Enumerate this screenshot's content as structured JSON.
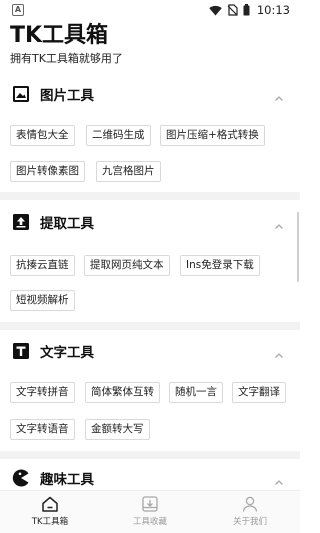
{
  "status_bar": {
    "app_badge": "A",
    "time": "10:13"
  },
  "header": {
    "title": "TK工具箱",
    "subtitle": "拥有TK工具箱就够用了"
  },
  "sections": [
    {
      "title": "图片工具",
      "icon": "image-icon",
      "items": [
        "表情包大全",
        "二维码生成",
        "图片压缩+格式转换",
        "图片转像素图",
        "九宫格图片"
      ]
    },
    {
      "title": "提取工具",
      "icon": "upload-box-icon",
      "items": [
        "抗揍云直链",
        "提取网页纯文本",
        "Ins免登录下载",
        "短视频解析"
      ]
    },
    {
      "title": "文字工具",
      "icon": "text-t-icon",
      "items": [
        "文字转拼音",
        "简体繁体互转",
        "随机一言",
        "文字翻译",
        "文字转语音",
        "金额转大写"
      ]
    },
    {
      "title": "趣味工具",
      "icon": "pacman-icon",
      "items": []
    }
  ],
  "bottom_nav": [
    {
      "label": "TK工具箱",
      "icon": "home-icon",
      "active": true
    },
    {
      "label": "工具收藏",
      "icon": "favorites-box-icon",
      "active": false
    },
    {
      "label": "关于我们",
      "icon": "person-icon",
      "active": false
    }
  ]
}
